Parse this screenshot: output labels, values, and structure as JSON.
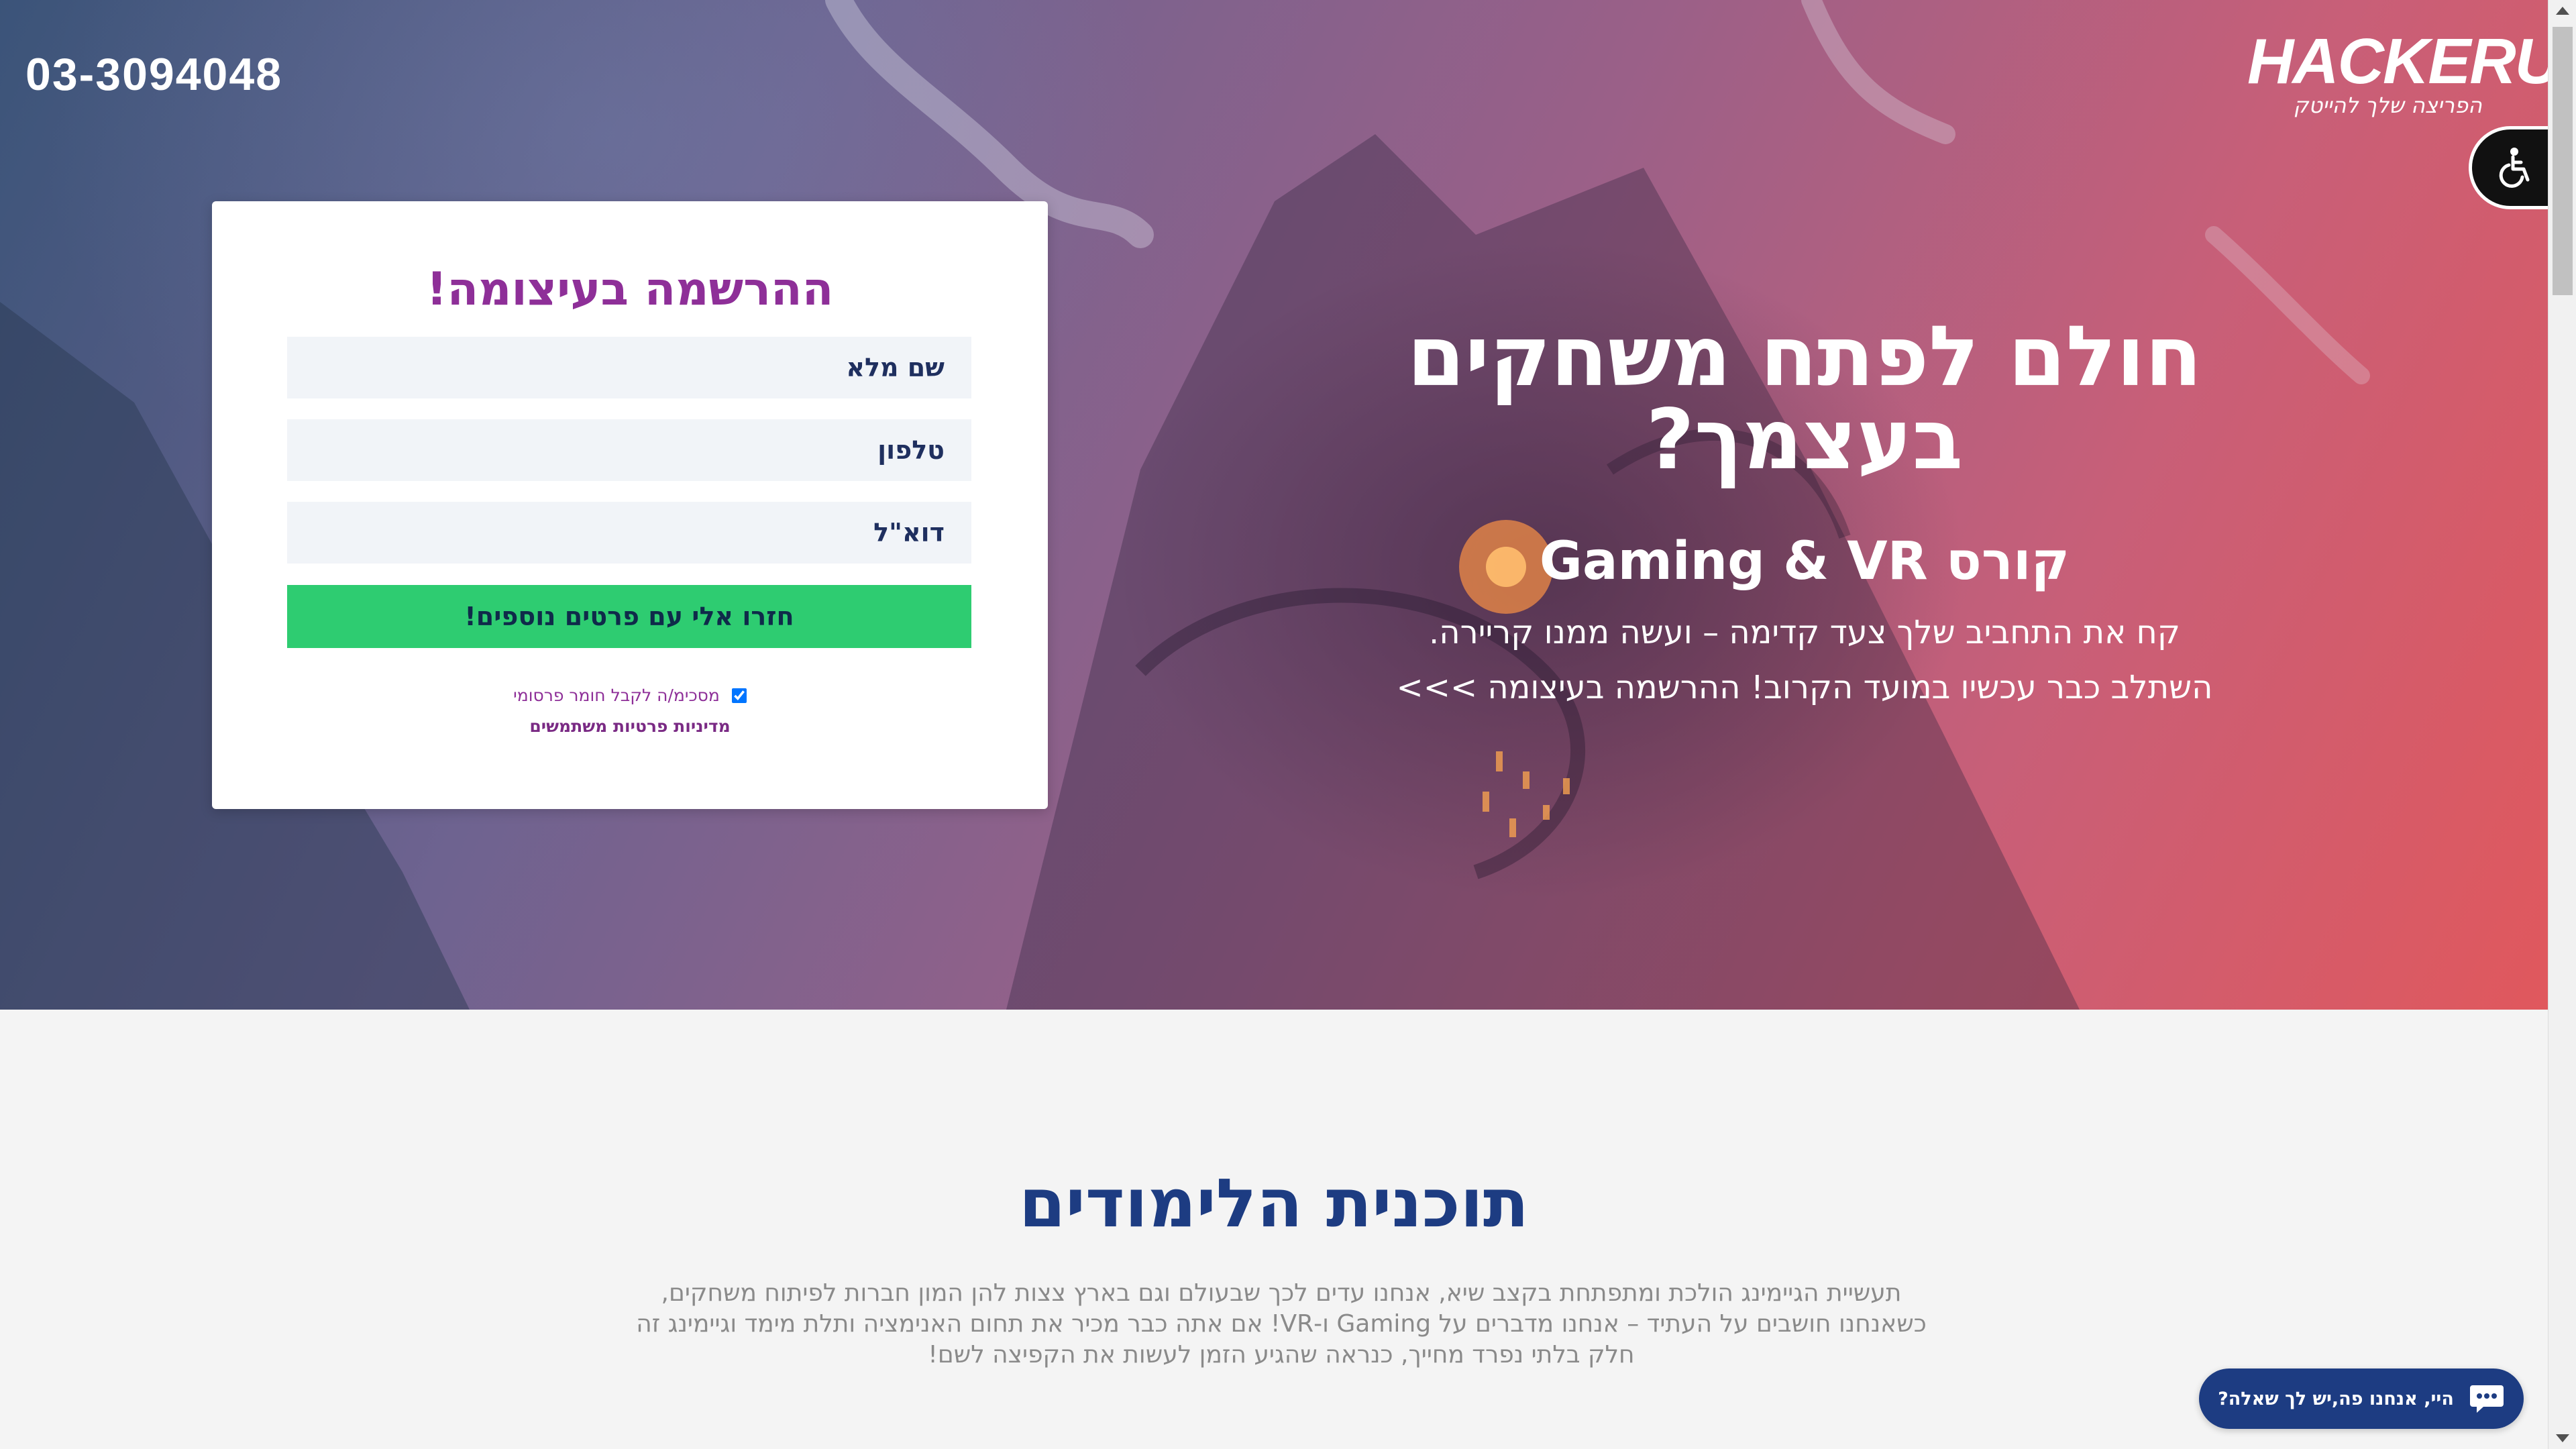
{
  "header": {
    "phone": "03-3094048",
    "logo_text": "HACKERU",
    "logo_tagline": "הפריצה שלך להייטק"
  },
  "form": {
    "title": "ההרשמה בעיצומה!",
    "fields": {
      "full_name_placeholder": "שם מלא",
      "phone_placeholder": "טלפון",
      "email_placeholder": "דוא\"ל"
    },
    "submit_label": "חזרו אלי עם פרטים נוספים!",
    "consent_label": "מסכימ/ה לקבל חומר פרסומי",
    "consent_checked": true,
    "privacy_link": "מדיניות פרטיות משתמשים"
  },
  "hero": {
    "title_line1": "חולם לפתח משחקים",
    "title_line2": "בעצמך?",
    "subtitle": "קורס Gaming & VR",
    "desc_line1": "קח את התחביב שלך צעד קדימה – ועשה ממנו קריירה.",
    "desc_line2": "השתלב כבר עכשיו במועד הקרוב! ההרשמה בעיצומה >>>"
  },
  "curriculum": {
    "title": "תוכנית הלימודים",
    "line1": "תעשיית הגיימינג הולכת ומתפתחת בקצב שיא, אנחנו עדים לכך שבעולם וגם בארץ צצות להן המון חברות לפיתוח משחקים,",
    "line2": "כשאנחנו חושבים על העתיד – אנחנו מדברים על Gaming ו-VR! אם אתה כבר מכיר את תחום האנימציה ותלת מימד וגיימינג זה",
    "line3": "חלק בלתי נפרד מחייך, כנראה שהגיע הזמן לעשות את הקפיצה לשם!"
  },
  "chat": {
    "label": "היי, אנחנו פה,יש לך שאלה?",
    "icon": "chat-bubble-icon"
  },
  "accessibility": {
    "icon": "wheelchair-icon"
  },
  "colors": {
    "brand_purple": "#8e2f98",
    "brand_navy": "#1d3c82",
    "submit_green": "#2ecc71",
    "hero_gradient_start": "#3b5479",
    "hero_gradient_end": "#e0585d"
  }
}
